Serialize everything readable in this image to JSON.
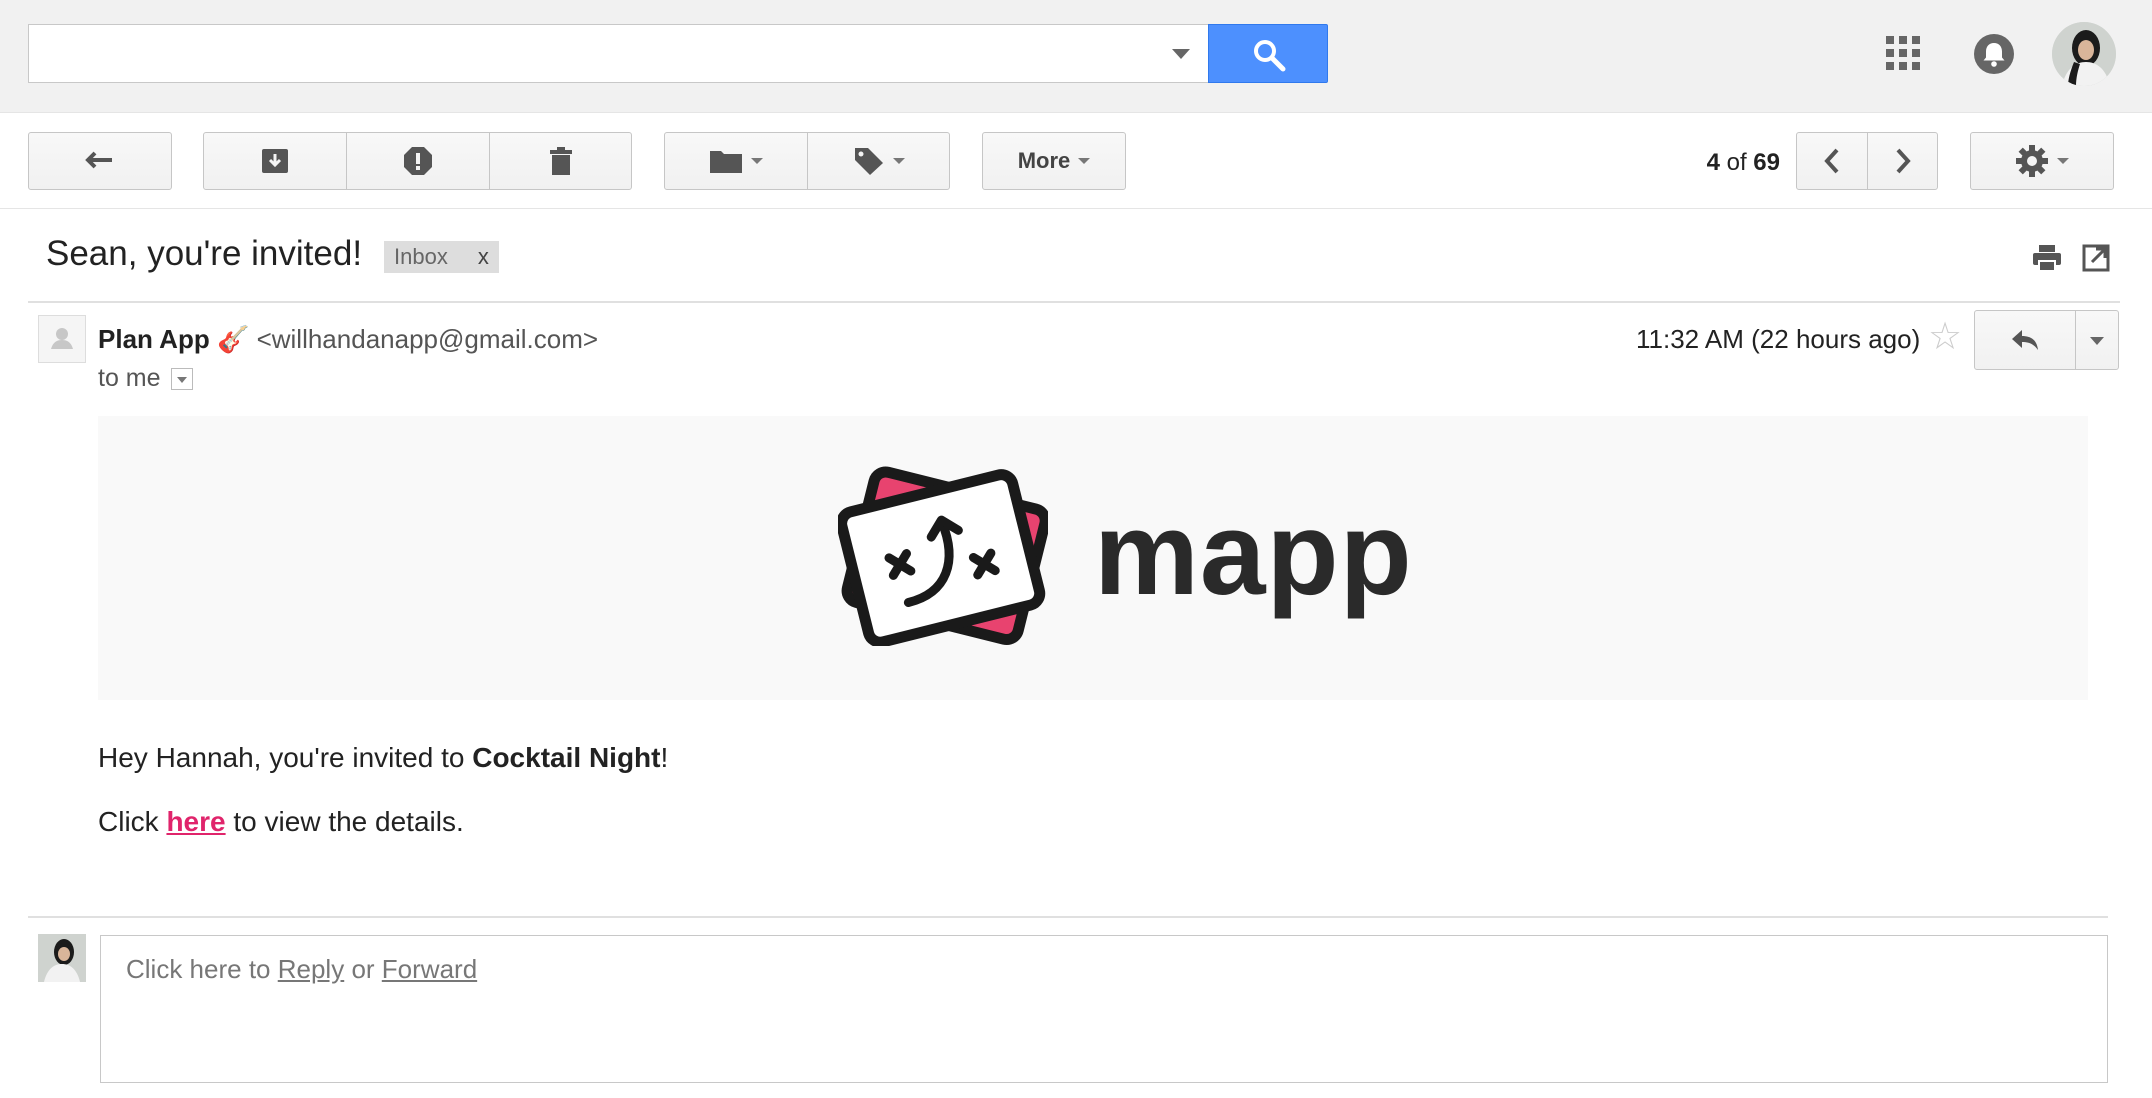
{
  "search": {
    "placeholder": "",
    "value": ""
  },
  "header": {
    "apps_icon": "apps-grid-icon",
    "notifications_icon": "bell-icon"
  },
  "toolbar": {
    "more_label": "More",
    "pager": {
      "current": "4",
      "of_label": "of",
      "total": "69"
    }
  },
  "message": {
    "subject": "Sean, you're invited!",
    "label": "Inbox",
    "label_remove": "x",
    "sender_name": "Plan App",
    "sender_emoji": "🎸",
    "sender_email": "<willhandanapp@gmail.com>",
    "recipient": "to me",
    "time": "11:32 AM (22 hours ago)",
    "brand": "mapp",
    "brand_colors": {
      "accent": "#e8436f",
      "ink": "#1a1a1a"
    },
    "greeting_prefix": "Hey Hannah, you're invited to ",
    "event_name": "Cocktail Night",
    "greeting_suffix": "!",
    "click_prefix": "Click ",
    "link_text": "here",
    "click_suffix": " to view the details."
  },
  "reply": {
    "prefix": "Click here to ",
    "reply_link": "Reply",
    "or": " or ",
    "forward_link": "Forward"
  }
}
